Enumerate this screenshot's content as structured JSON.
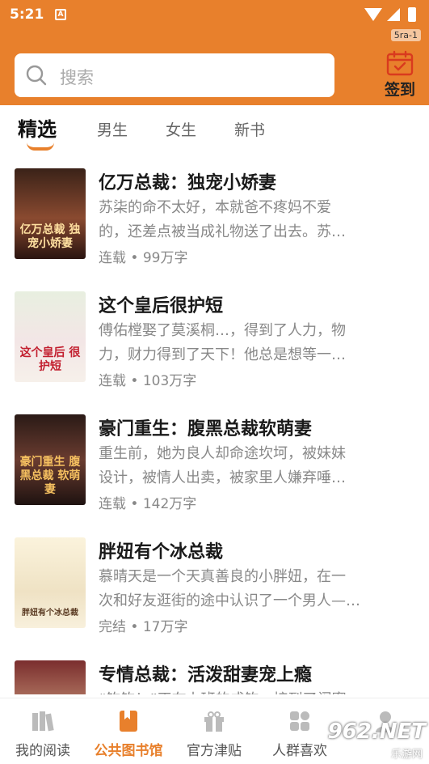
{
  "status_bar": {
    "time": "5:21",
    "notification_icon": "A",
    "version": "5ra-1"
  },
  "search": {
    "placeholder": "搜索"
  },
  "checkin": {
    "label": "签到"
  },
  "tabs": [
    {
      "label": "精选",
      "active": true
    },
    {
      "label": "男生",
      "active": false
    },
    {
      "label": "女生",
      "active": false
    },
    {
      "label": "新书",
      "active": false
    }
  ],
  "books": [
    {
      "title": "亿万总裁：独宠小娇妻",
      "desc_line1": "苏柒的命不太好，本就爸不疼妈不爱",
      "desc_line2": "的，还差点被当成礼物送了出去。苏…",
      "status": "连载",
      "words": "99万字",
      "cover_text": "亿万总裁 独宠小娇妻",
      "cover_color": "#6b3a2a"
    },
    {
      "title": "这个皇后很护短",
      "desc_line1": "傅佑樘娶了莫溪桐…，得到了人力，物",
      "desc_line2": "力，财力得到了天下！他总是想等一…",
      "status": "连载",
      "words": "103万字",
      "cover_text": "这个皇后 很护短",
      "cover_color": "#d9e6d0"
    },
    {
      "title": "豪门重生：腹黑总裁软萌妻",
      "desc_line1": "重生前，她为良人却命途坎坷，被妹妹",
      "desc_line2": "设计，被情人出卖，被家里人嫌弃唾…",
      "status": "连载",
      "words": "142万字",
      "cover_text": "豪门重生 腹黑总裁 软萌妻",
      "cover_color": "#4a2a22"
    },
    {
      "title": "胖妞有个冰总裁",
      "desc_line1": "慕晴天是一个天真善良的小胖妞，在一",
      "desc_line2": "次和好友逛街的途中认识了一个男人—…",
      "status": "完结",
      "words": "17万字",
      "cover_text": "胖妞有个冰总裁",
      "cover_color": "#f4ead0"
    },
    {
      "title": "专情总裁：活泼甜妻宠上瘾",
      "desc_line1": "“钩钩！”正在上班的成钩，接到了闺蜜",
      "desc_line2": "",
      "status": "",
      "words": "",
      "cover_text": "",
      "cover_color": "#8a3a3a"
    }
  ],
  "bottom_nav": [
    {
      "label": "我的阅读",
      "icon": "books-icon",
      "active": false
    },
    {
      "label": "公共图书馆",
      "icon": "library-icon",
      "active": true
    },
    {
      "label": "官方津贴",
      "icon": "gift-icon",
      "active": false
    },
    {
      "label": "人群喜欢",
      "icon": "grid-icon",
      "active": false
    },
    {
      "label": "",
      "icon": "profile-icon",
      "active": false
    }
  ],
  "watermark": {
    "main": "962.NET",
    "sub": "乐游网"
  },
  "colors": {
    "accent": "#e8802c"
  }
}
